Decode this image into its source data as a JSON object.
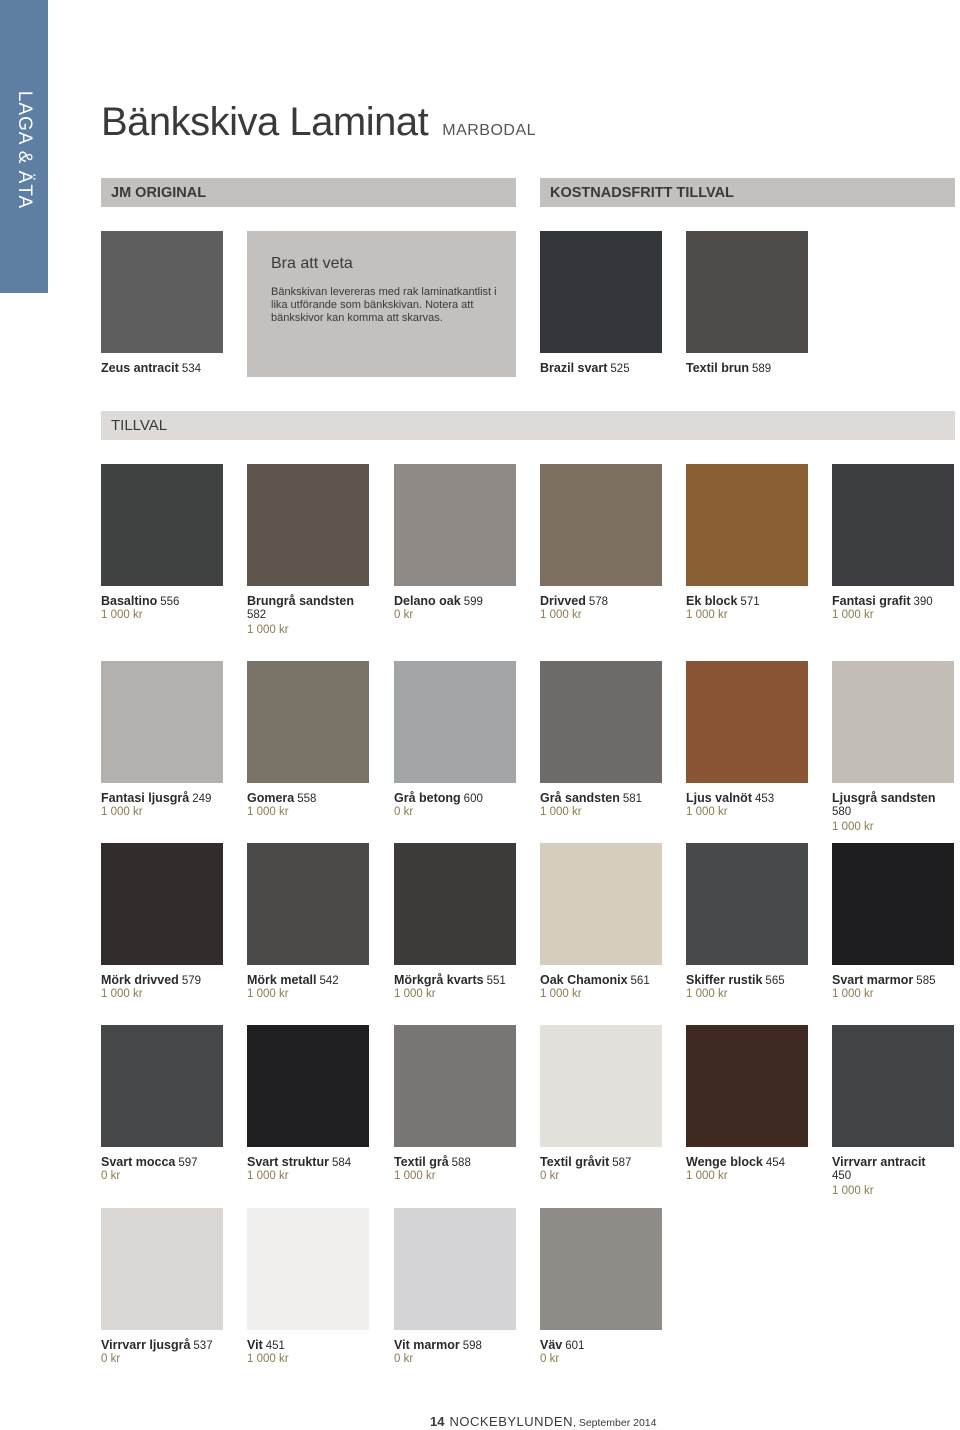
{
  "side_tab": "LAGA & ÄTA",
  "title": "Bänkskiva Laminat",
  "subtitle": "MARBODAL",
  "sections": {
    "original": "JM ORIGINAL",
    "free": "KOSTNADSFRITT TILLVAL",
    "tillval": "TILLVAL"
  },
  "info": {
    "title": "Bra att veta",
    "text": "Bänkskivan levereras med rak laminatkantlist i lika utförande som bänkskivan. Notera att bänkskivor kan komma att skarvas."
  },
  "top_items": [
    {
      "name": "Zeus antracit",
      "code": "534",
      "price": "",
      "col": 0,
      "wrap": false,
      "bg": "#5e5e5e"
    },
    {
      "name": "Brazil svart",
      "code": "525",
      "price": "",
      "col": 3,
      "wrap": false,
      "bg": "#33363a"
    },
    {
      "name": "Textil brun",
      "code": "589",
      "price": "",
      "col": 4,
      "wrap": false,
      "bg": "#4f4b48"
    }
  ],
  "grid_rows": [
    [
      {
        "name": "Basaltino",
        "code": "556",
        "price": "1 000 kr",
        "wrap": false,
        "bg": "#404241"
      },
      {
        "name": "Brungrå sandsten",
        "code": "582",
        "price": "1 000 kr",
        "wrap": true,
        "bg": "#5e554c"
      },
      {
        "name": "Delano oak",
        "code": "599",
        "price": "0 kr",
        "wrap": false,
        "bg": "#8f8a85"
      },
      {
        "name": "Drivved",
        "code": "578",
        "price": "1 000 kr",
        "wrap": false,
        "bg": "#7d7062"
      },
      {
        "name": "Ek block",
        "code": "571",
        "price": "1 000 kr",
        "wrap": false,
        "bg": "#8a5f33"
      },
      {
        "name": "Fantasi grafit",
        "code": "390",
        "price": "1 000 kr",
        "wrap": false,
        "bg": "#3c3e41"
      }
    ],
    [
      {
        "name": "Fantasi ljusgrå",
        "code": "249",
        "price": "1 000 kr",
        "wrap": false,
        "bg": "#b3b0ae"
      },
      {
        "name": "Gomera",
        "code": "558",
        "price": "1 000 kr",
        "wrap": false,
        "bg": "#7a7368"
      },
      {
        "name": "Grå betong",
        "code": "600",
        "price": "0 kr",
        "wrap": false,
        "bg": "#a3a6a6"
      },
      {
        "name": "Grå sandsten",
        "code": "581",
        "price": "1 000 kr",
        "wrap": false,
        "bg": "#6e6b69"
      },
      {
        "name": "Ljus valnöt",
        "code": "453",
        "price": "1 000 kr",
        "wrap": false,
        "bg": "#8a5535"
      },
      {
        "name": "Ljusgrå sandsten",
        "code": "580",
        "price": "1 000 kr",
        "wrap": true,
        "bg": "#c2bdb7"
      }
    ],
    [
      {
        "name": "Mörk drivved",
        "code": "579",
        "price": "1 000 kr",
        "wrap": false,
        "bg": "#322d2c"
      },
      {
        "name": "Mörk metall",
        "code": "542",
        "price": "1 000 kr",
        "wrap": false,
        "bg": "#4c4a49"
      },
      {
        "name": "Mörkgrå kvarts",
        "code": "551",
        "price": "1 000 kr",
        "wrap": false,
        "bg": "#3d3a39"
      },
      {
        "name": "Oak Chamonix",
        "code": "561",
        "price": "1 000 kr",
        "wrap": false,
        "bg": "#d6cdbd"
      },
      {
        "name": "Skiffer rustik",
        "code": "565",
        "price": "1 000 kr",
        "wrap": false,
        "bg": "#474a4b"
      },
      {
        "name": "Svart marmor",
        "code": "585",
        "price": "1 000 kr",
        "wrap": false,
        "bg": "#1e1e20"
      }
    ],
    [
      {
        "name": "Svart mocca",
        "code": "597",
        "price": "0 kr",
        "wrap": false,
        "bg": "#454748"
      },
      {
        "name": "Svart struktur",
        "code": "584",
        "price": "1 000 kr",
        "wrap": false,
        "bg": "#1f1f21"
      },
      {
        "name": "Textil grå",
        "code": "588",
        "price": "1 000 kr",
        "wrap": false,
        "bg": "#7a7675"
      },
      {
        "name": "Textil gråvit",
        "code": "587",
        "price": "0 kr",
        "wrap": false,
        "bg": "#e4e0dc"
      },
      {
        "name": "Wenge block",
        "code": "454",
        "price": "1 000 kr",
        "wrap": false,
        "bg": "#3e2a22"
      },
      {
        "name": "Virrvarr antracit",
        "code": "450",
        "price": "1 000 kr",
        "wrap": true,
        "bg": "#404447"
      }
    ],
    [
      {
        "name": "Virrvarr ljusgrå",
        "code": "537",
        "price": "0 kr",
        "wrap": false,
        "bg": "#dad7d5"
      },
      {
        "name": "Vit",
        "code": "451",
        "price": "1 000 kr",
        "wrap": false,
        "bg": "#f1efed"
      },
      {
        "name": "Vit marmor",
        "code": "598",
        "price": "0 kr",
        "wrap": false,
        "bg": "#d4d4d6"
      },
      {
        "name": "Väv",
        "code": "601",
        "price": "0 kr",
        "wrap": false,
        "bg": "#8f8b87"
      }
    ]
  ],
  "footer": {
    "page": "14",
    "magazine": "NOCKEBYLUNDEN",
    "date": ", September 2014"
  }
}
